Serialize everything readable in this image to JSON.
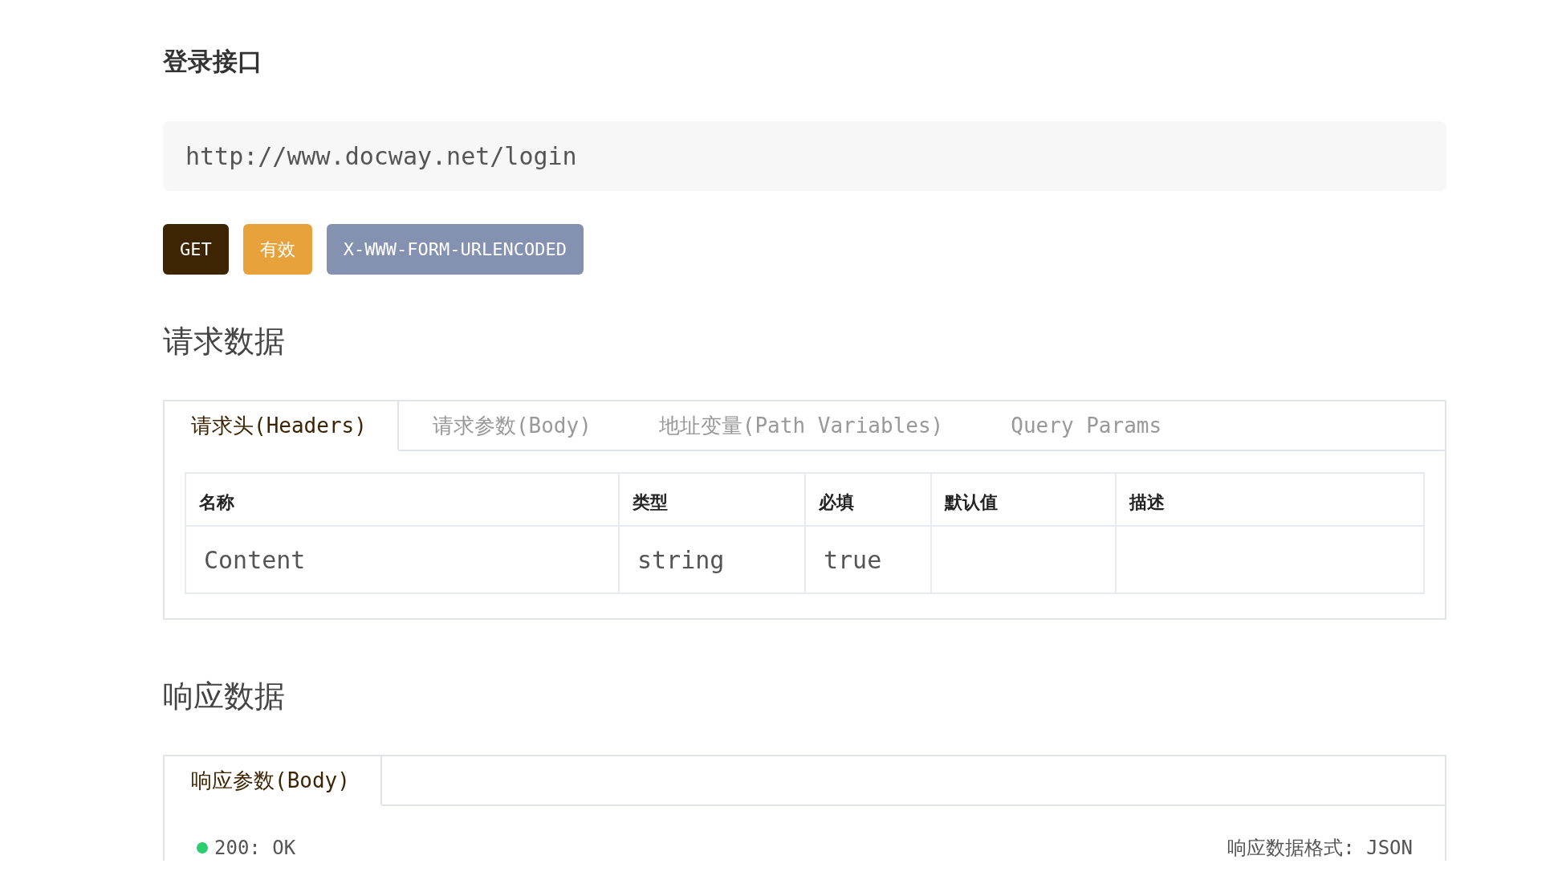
{
  "title": "登录接口",
  "url": "http://www.docway.net/login",
  "badges": [
    {
      "label": "GET",
      "color": "#3d2503"
    },
    {
      "label": "有效",
      "color": "#e8a23c"
    },
    {
      "label": "X-WWW-FORM-URLENCODED",
      "color": "#8491b0"
    }
  ],
  "request": {
    "heading": "请求数据",
    "tabs": [
      {
        "label": "请求头(Headers)",
        "selected": true
      },
      {
        "label": "请求参数(Body)",
        "selected": false
      },
      {
        "label": "地址变量(Path Variables)",
        "selected": false
      },
      {
        "label": "Query Params",
        "selected": false
      }
    ],
    "table": {
      "columns": [
        "名称",
        "类型",
        "必填",
        "默认值",
        "描述"
      ],
      "rows": [
        [
          "Content",
          "string",
          "true",
          "",
          ""
        ]
      ]
    }
  },
  "response": {
    "heading": "响应数据",
    "tabs": [
      {
        "label": "响应参数(Body)",
        "selected": true
      }
    ],
    "status": "200: OK",
    "format": "响应数据格式: JSON"
  }
}
